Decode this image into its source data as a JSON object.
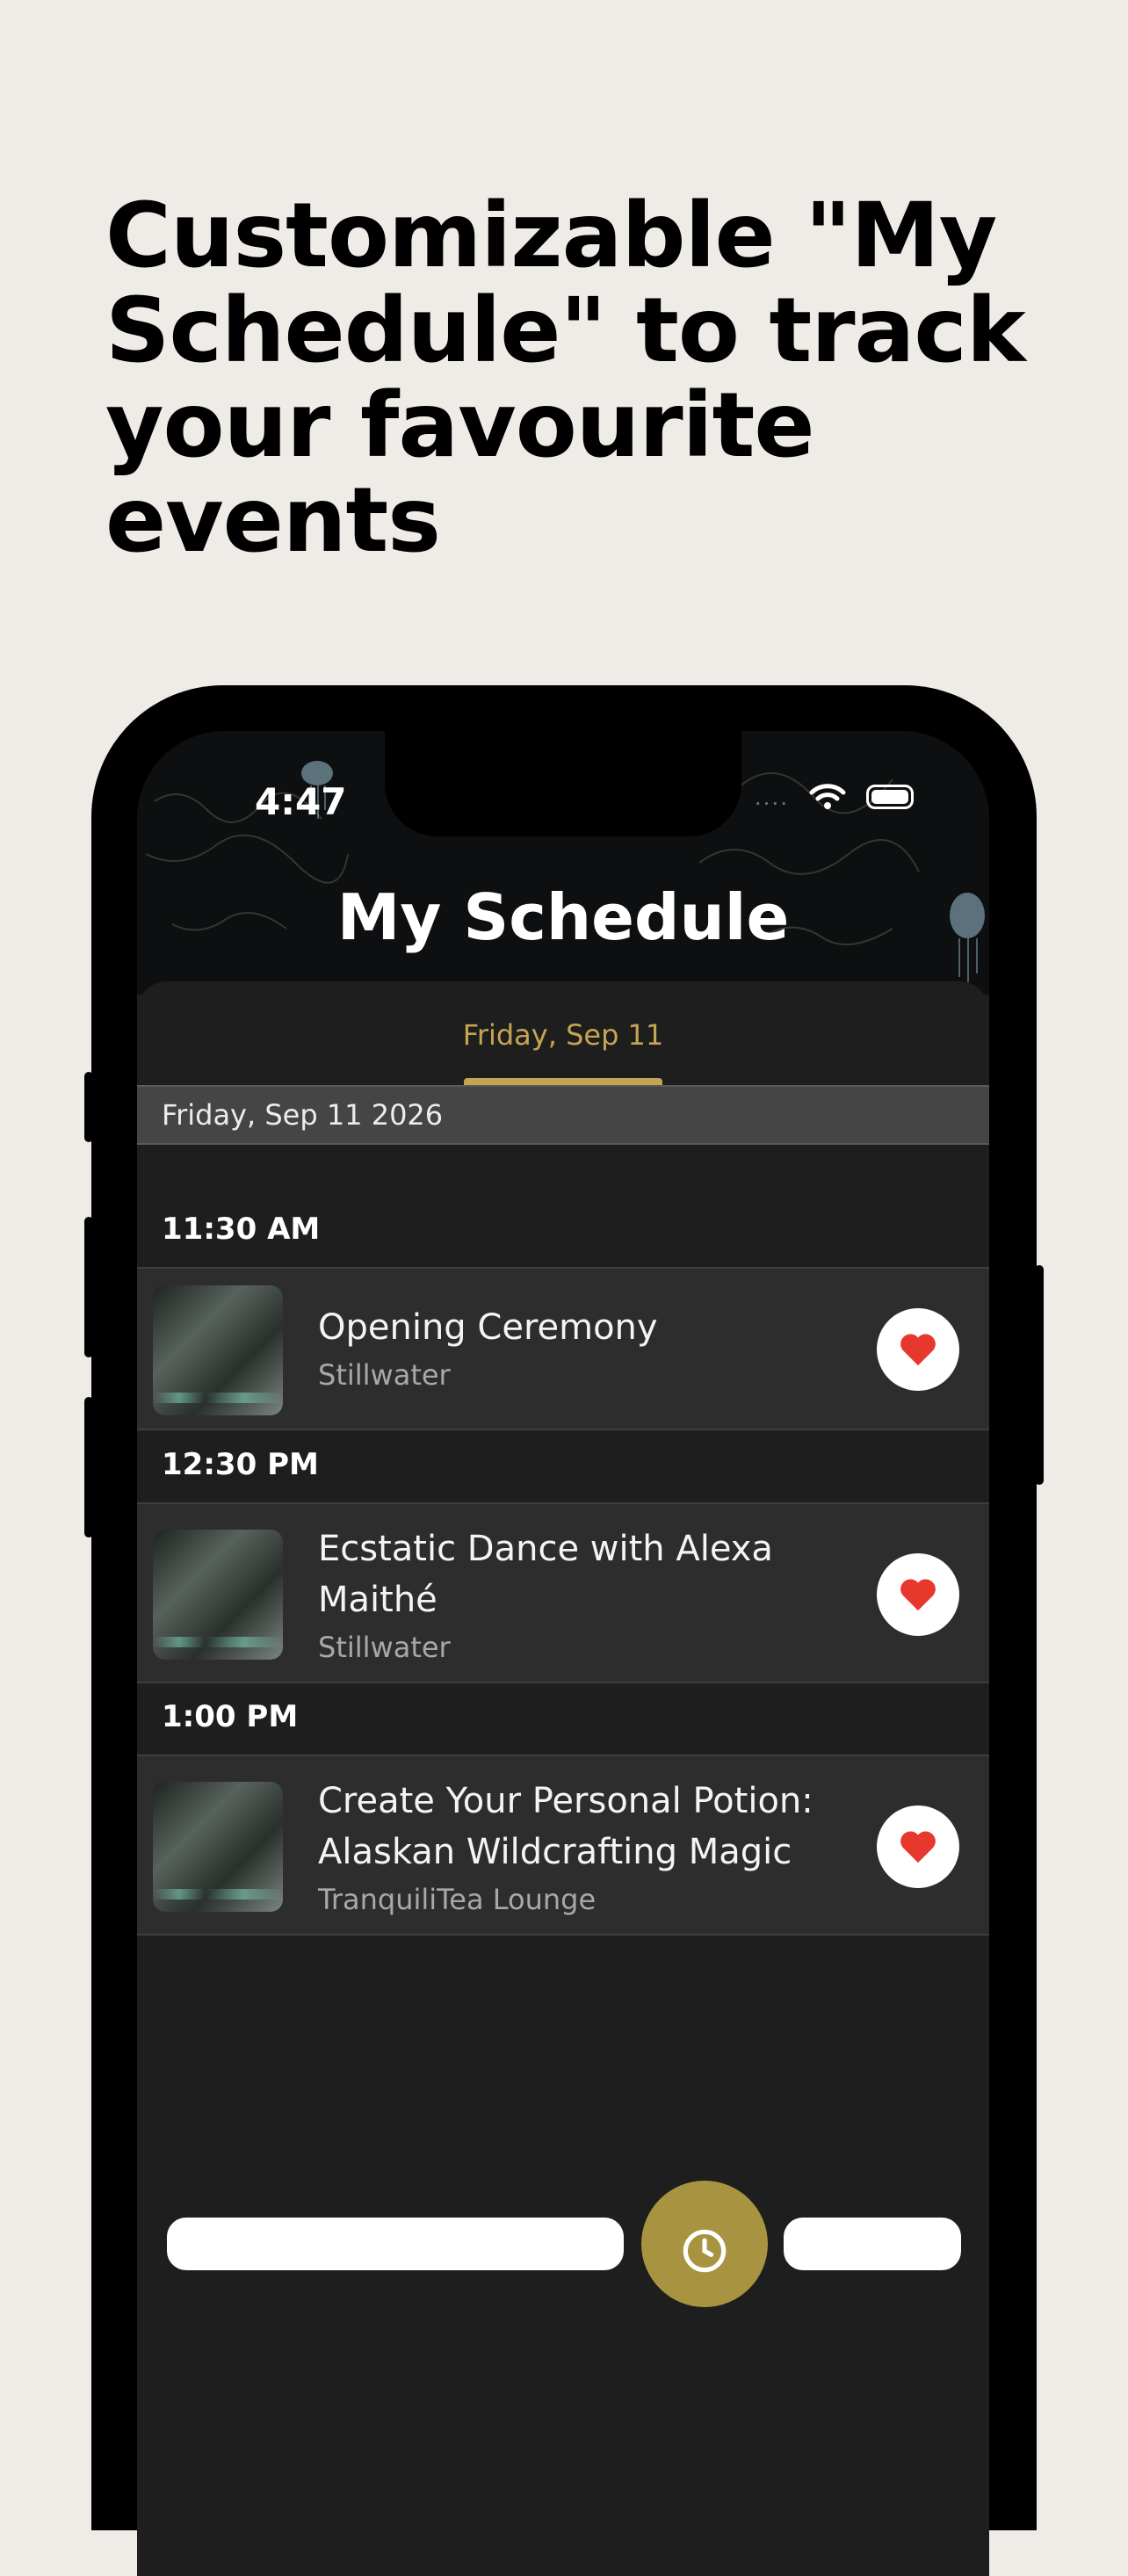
{
  "headline": {
    "line1": "Customizable \"My",
    "line2": "Schedule\" to track",
    "line3": "your favourite events"
  },
  "status_bar": {
    "time": "4:47",
    "signal": "....",
    "icons": [
      "wifi-icon",
      "battery-icon"
    ]
  },
  "screen": {
    "title": "My Schedule",
    "date_tab": "Friday, Sep 11",
    "date_bar": "Friday, Sep 11 2026"
  },
  "schedule": [
    {
      "time": "11:30 AM",
      "events": [
        {
          "title": "Opening Ceremony",
          "venue": "Stillwater",
          "favourite": true
        }
      ]
    },
    {
      "time": "12:30 PM",
      "events": [
        {
          "title": "Ecstatic Dance with Alexa Maithé",
          "venue": "Stillwater",
          "favourite": true
        }
      ]
    },
    {
      "time": "1:00 PM",
      "events": [
        {
          "title": "Create Your Personal Potion: Alaskan Wildcrafting Magic",
          "venue": "TranquiliTea Lounge",
          "favourite": true
        }
      ]
    }
  ],
  "colors": {
    "background": "#efece7",
    "accent": "#c5a552",
    "fab": "#a89440",
    "heart": "#e8372c",
    "row": "#2d2d2d"
  }
}
